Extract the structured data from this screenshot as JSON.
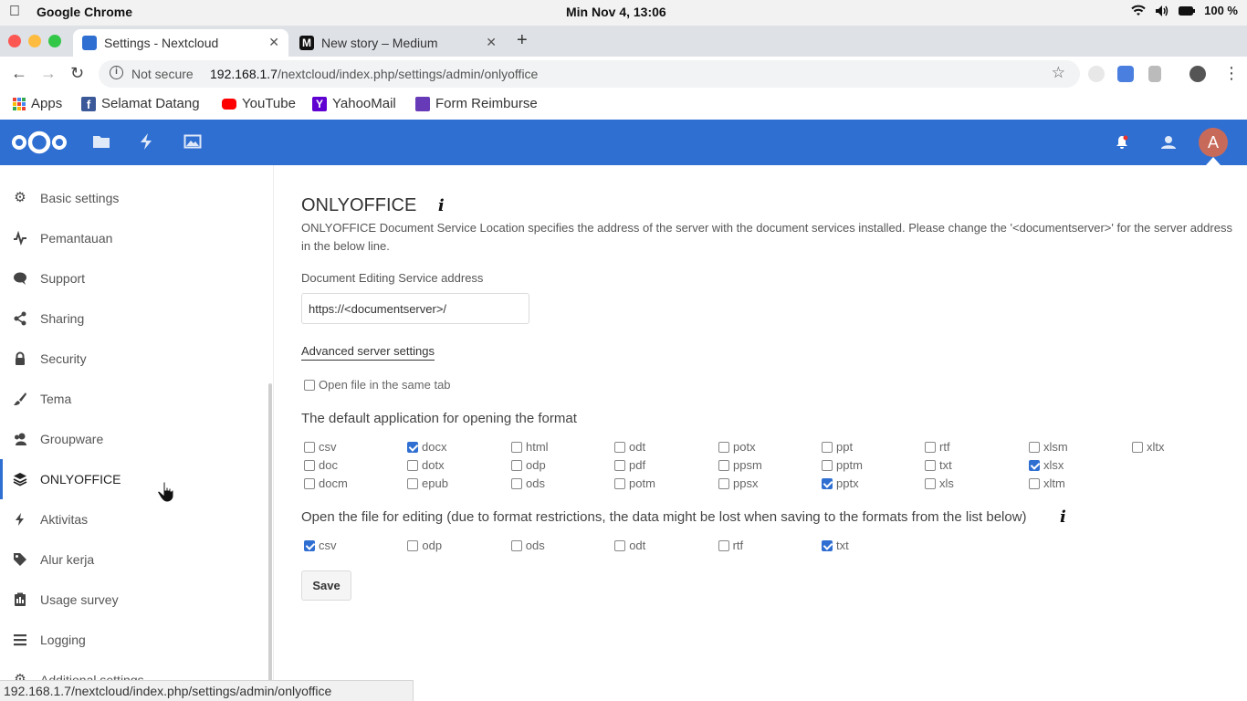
{
  "os": {
    "app_name": "Google Chrome",
    "clock": "Min Nov  4, 13:06",
    "battery": "100 %"
  },
  "tabs": [
    {
      "title": "Settings - Nextcloud",
      "active": true
    },
    {
      "title": "New story – Medium",
      "active": false
    }
  ],
  "address": {
    "security": "Not secure",
    "host": "192.168.1.7",
    "path": "/nextcloud/index.php/settings/admin/onlyoffice"
  },
  "bookmarks": [
    {
      "label": "Apps",
      "icon": "apps-grid-icon",
      "color": "#4285f4"
    },
    {
      "label": "Selamat Datang",
      "icon": "facebook-icon",
      "color": "#3b5998"
    },
    {
      "label": "YouTube",
      "icon": "youtube-icon",
      "color": "#ff0000"
    },
    {
      "label": "YahooMail",
      "icon": "yahoo-icon",
      "color": "#5f01d1"
    },
    {
      "label": "Form Reimburse",
      "icon": "forms-icon",
      "color": "#673ab7"
    }
  ],
  "sidebar": {
    "items": [
      {
        "label": "Basic settings",
        "icon": "gear-icon"
      },
      {
        "label": "Pemantauan",
        "icon": "activity-pulse-icon"
      },
      {
        "label": "Support",
        "icon": "speech-bubble-icon"
      },
      {
        "label": "Sharing",
        "icon": "share-icon"
      },
      {
        "label": "Security",
        "icon": "lock-icon"
      },
      {
        "label": "Tema",
        "icon": "paintbrush-icon"
      },
      {
        "label": "Groupware",
        "icon": "group-icon"
      },
      {
        "label": "ONLYOFFICE",
        "icon": "layers-icon",
        "active": true
      },
      {
        "label": "Aktivitas",
        "icon": "lightning-icon"
      },
      {
        "label": "Alur kerja",
        "icon": "tag-icon"
      },
      {
        "label": "Usage survey",
        "icon": "clipboard-icon"
      },
      {
        "label": "Logging",
        "icon": "list-icon"
      },
      {
        "label": "Additional settings",
        "icon": "gear-icon"
      }
    ]
  },
  "main": {
    "title": "ONLYOFFICE",
    "description": "ONLYOFFICE Document Service Location specifies the address of the server with the document services installed. Please change the '<documentserver>' for the server address in the below line.",
    "address_label": "Document Editing Service address",
    "address_value": "https://<documentserver>/",
    "advanced_link": "Advanced server settings",
    "same_tab_label": "Open file in the same tab",
    "same_tab_checked": false,
    "default_app_heading": "The default application for opening the format",
    "default_formats": [
      {
        "label": "csv",
        "checked": false
      },
      {
        "label": "docx",
        "checked": true
      },
      {
        "label": "html",
        "checked": false
      },
      {
        "label": "odt",
        "checked": false
      },
      {
        "label": "potx",
        "checked": false
      },
      {
        "label": "ppt",
        "checked": false
      },
      {
        "label": "rtf",
        "checked": false
      },
      {
        "label": "xlsm",
        "checked": false
      },
      {
        "label": "xltx",
        "checked": false
      },
      {
        "label": "doc",
        "checked": false
      },
      {
        "label": "dotx",
        "checked": false
      },
      {
        "label": "odp",
        "checked": false
      },
      {
        "label": "pdf",
        "checked": false
      },
      {
        "label": "ppsm",
        "checked": false
      },
      {
        "label": "pptm",
        "checked": false
      },
      {
        "label": "txt",
        "checked": false
      },
      {
        "label": "xlsx",
        "checked": true
      },
      {
        "label": "docm",
        "checked": false
      },
      {
        "label": "epub",
        "checked": false
      },
      {
        "label": "ods",
        "checked": false
      },
      {
        "label": "potm",
        "checked": false
      },
      {
        "label": "ppsx",
        "checked": false
      },
      {
        "label": "pptx",
        "checked": true
      },
      {
        "label": "xls",
        "checked": false
      },
      {
        "label": "xltm",
        "checked": false
      }
    ],
    "edit_heading": "Open the file for editing (due to format restrictions, the data might be lost when saving to the formats from the list below)",
    "edit_formats": [
      {
        "label": "csv",
        "checked": true
      },
      {
        "label": "odp",
        "checked": false
      },
      {
        "label": "ods",
        "checked": false
      },
      {
        "label": "odt",
        "checked": false
      },
      {
        "label": "rtf",
        "checked": false
      },
      {
        "label": "txt",
        "checked": true
      }
    ],
    "save_label": "Save"
  },
  "statusbar": {
    "url": "192.168.1.7/nextcloud/index.php/settings/admin/onlyoffice"
  },
  "header": {
    "avatar_letter": "A",
    "color": "#2f6fd2"
  }
}
